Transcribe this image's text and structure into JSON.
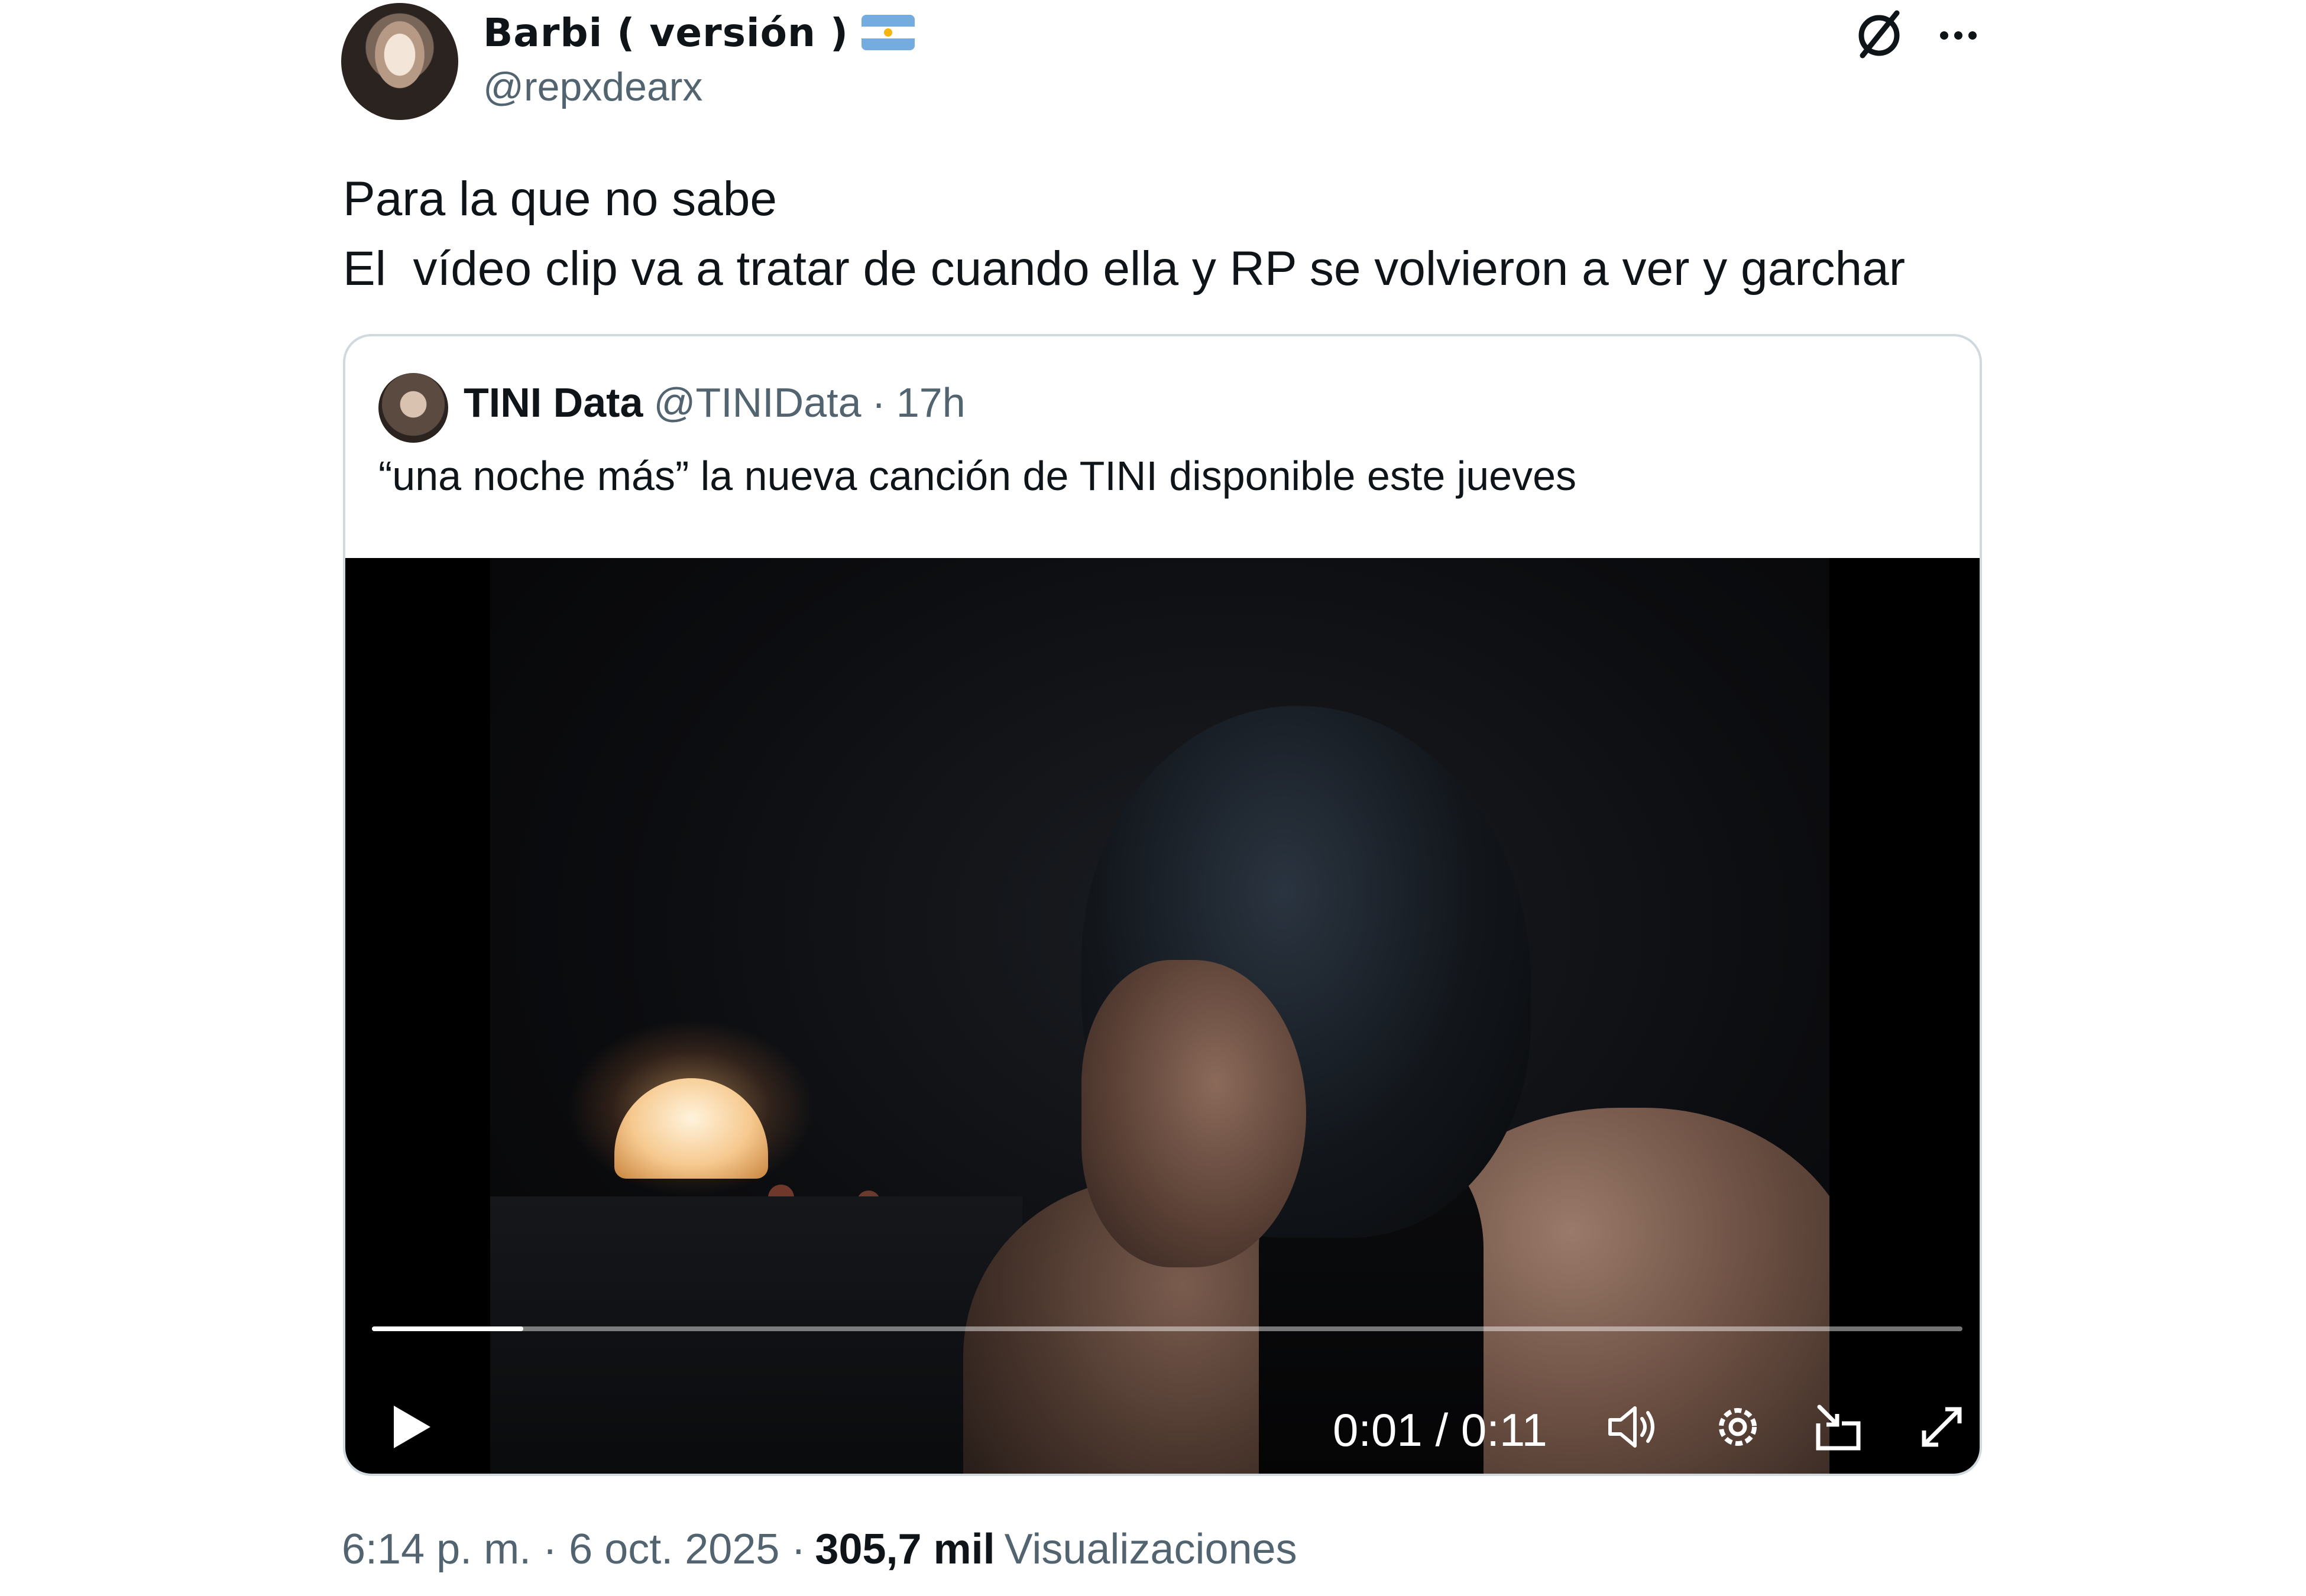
{
  "author": {
    "display_name": "Barbi ( versión )",
    "flag_icon": "argentina-flag-icon",
    "handle": "@repxdearx"
  },
  "header_icons": [
    "grok-icon",
    "more-icon"
  ],
  "tweet": {
    "lines": [
      "Para la que no sabe",
      "El  vídeo clip va a tratar de cuando ella y RP se volvieron a ver y garchar"
    ]
  },
  "quoted": {
    "name": "TINI Data",
    "handle": "@TINIData",
    "separator": "·",
    "time": "17h",
    "text": "“una noche más” la nueva canción de TINI disponible este jueves"
  },
  "video": {
    "time_display": "0:01 / 0:11",
    "progress_fraction": 0.095,
    "controls": [
      "play-icon",
      "volume-icon",
      "settings-icon",
      "picture-in-picture-icon",
      "fullscreen-icon"
    ]
  },
  "footer": {
    "time_date": "6:14 p. m. · 6 oct. 2025 ·",
    "views_count": "305,7 mil",
    "views_label": "Visualizaciones"
  },
  "colors": {
    "text_primary": "#0f1419",
    "text_secondary": "#536471",
    "border": "#cfd9de",
    "video_bg": "#000000"
  }
}
